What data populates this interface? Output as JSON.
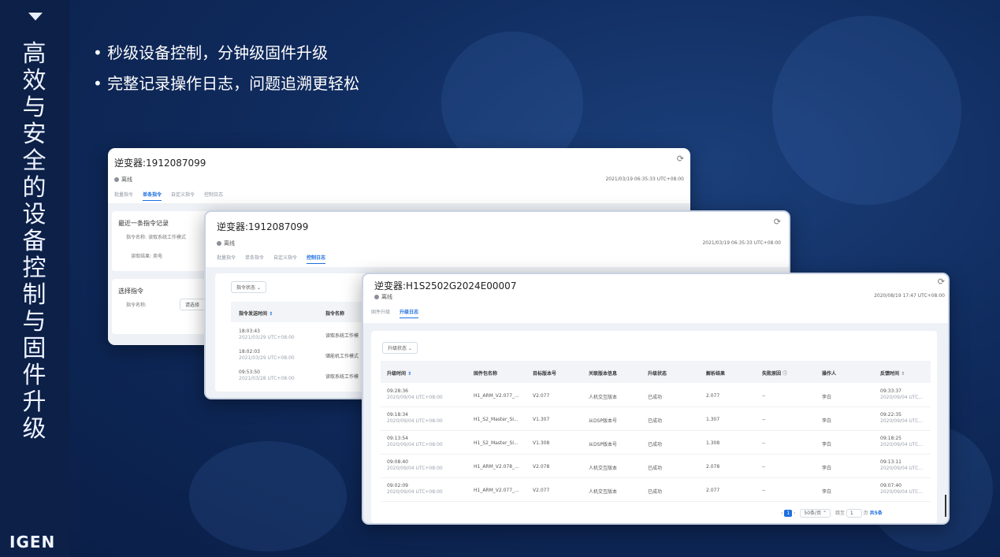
{
  "sidebar": {
    "title": "高效与安全的设备 控制与固件升级",
    "logo": "IGEN"
  },
  "bullets": [
    "秒级设备控制，分钟级固件升级",
    "完整记录操作日志，问题追溯更轻松"
  ],
  "card1": {
    "title": "逆变器:1912087099",
    "status": "离线",
    "timestamp": "2021/03/19 06:35:33 UTC+08:00",
    "tabs": [
      "批量指令",
      "单条指令",
      "自定义指令",
      "控制日志"
    ],
    "recent": {
      "heading": "最近一条指令记录",
      "cmd_label": "指令名称:",
      "cmd_value": "读取系统工作模式",
      "result_label": "读取结果:",
      "result_value": "卖电"
    },
    "select": {
      "heading": "选择指令",
      "cmd_label": "指令名称:",
      "placeholder": "请选择"
    }
  },
  "card2": {
    "title": "逆变器:1912087099",
    "status": "离线",
    "timestamp": "2021/03/19 06:35:33 UTC+08:00",
    "tabs": [
      "批量指令",
      "单条指令",
      "自定义指令",
      "控制日志"
    ],
    "filter": "指令状态",
    "headers": [
      "指令发送时间",
      "指令名称"
    ],
    "rows": [
      {
        "time": "18:03:43",
        "date": "2021/03/29 UTC+08:00",
        "name": "读取系统工作模"
      },
      {
        "time": "18:02:03",
        "date": "2021/03/29 UTC+08:00",
        "name": "储能机工作模式"
      },
      {
        "time": "09:53:50",
        "date": "2021/03/28 UTC+08:00",
        "name": "读取系统工作模"
      }
    ]
  },
  "card3": {
    "title": "逆变器:H1S2502G2024E00007",
    "status": "离线",
    "timestamp": "2020/08/19 17:47 UTC+08:00",
    "tabs": [
      "固件升级",
      "升级日志"
    ],
    "filter": "升级状态",
    "headers": [
      "升级时间",
      "固件包名称",
      "目标版本号",
      "关联版本信息",
      "升级状态",
      "解析结果",
      "失败原因",
      "操作人",
      "反馈时间"
    ],
    "rows": [
      {
        "time": "09:28:36",
        "date": "2020/09/04 UTC+08:00",
        "pkg": "H1_ARM_V2.077_...",
        "ver": "V2.077",
        "rel": "人机交互版本",
        "state": "已成功",
        "parse": "2.077",
        "reason": "--",
        "op": "李白",
        "fb_time": "09:33:37",
        "fb_date": "2020/09/04 UTC..."
      },
      {
        "time": "09:18:34",
        "date": "2020/09/04 UTC+08:00",
        "pkg": "H1_S2_Master_SI...",
        "ver": "V1.307",
        "rel": "从DSP版本号",
        "state": "已成功",
        "parse": "1.307",
        "reason": "--",
        "op": "李白",
        "fb_time": "09:22:35",
        "fb_date": "2020/09/04 UTC..."
      },
      {
        "time": "09:13:54",
        "date": "2020/09/04 UTC+08:00",
        "pkg": "H1_S2_Master_SI...",
        "ver": "V1.308",
        "rel": "从DSP版本号",
        "state": "已成功",
        "parse": "1.308",
        "reason": "--",
        "op": "李白",
        "fb_time": "09:18:25",
        "fb_date": "2020/09/04 UTC..."
      },
      {
        "time": "09:08:40",
        "date": "2020/09/04 UTC+08:00",
        "pkg": "H1_ARM_V2.078_...",
        "ver": "V2.078",
        "rel": "人机交互版本",
        "state": "已成功",
        "parse": "2.078",
        "reason": "--",
        "op": "李白",
        "fb_time": "09:13:11",
        "fb_date": "2020/09/04 UTC..."
      },
      {
        "time": "09:02:09",
        "date": "2020/09/04 UTC+08:00",
        "pkg": "H1_ARM_V2.077_...",
        "ver": "V2.077",
        "rel": "人机交互版本",
        "state": "已成功",
        "parse": "2.077",
        "reason": "--",
        "op": "李白",
        "fb_time": "09:07:40",
        "fb_date": "2020/09/04 UTC..."
      }
    ],
    "pager": {
      "current": "1",
      "per_page": "50条/页",
      "jump_label": "跳至",
      "jump_value": "1",
      "total_prefix": "页",
      "total": "共5条"
    }
  }
}
